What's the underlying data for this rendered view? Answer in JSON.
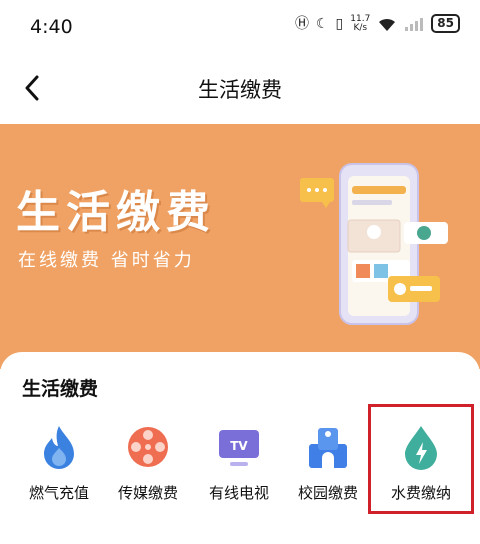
{
  "status_bar": {
    "time": "4:40",
    "net_speed_value": "11.7",
    "net_speed_unit": "K/s",
    "battery": "85"
  },
  "nav": {
    "title": "生活缴费"
  },
  "banner": {
    "title": "生活缴费",
    "subtitle": "在线缴费 省时省力"
  },
  "section": {
    "title": "生活缴费"
  },
  "services": [
    {
      "label": "燃气充值",
      "icon": "flame-icon",
      "color": "#3b82e0"
    },
    {
      "label": "传媒缴费",
      "icon": "film-reel-icon",
      "color": "#ef6e52"
    },
    {
      "label": "有线电视",
      "icon": "tv-icon",
      "color": "#7a6fd8"
    },
    {
      "label": "校园缴费",
      "icon": "school-building-icon",
      "color": "#3f7fe6"
    },
    {
      "label": "水费缴纳",
      "icon": "water-drop-bolt-icon",
      "color": "#3fae9c"
    }
  ],
  "colors": {
    "banner_bg": "#f0a264",
    "highlight_border": "#d0212a"
  }
}
